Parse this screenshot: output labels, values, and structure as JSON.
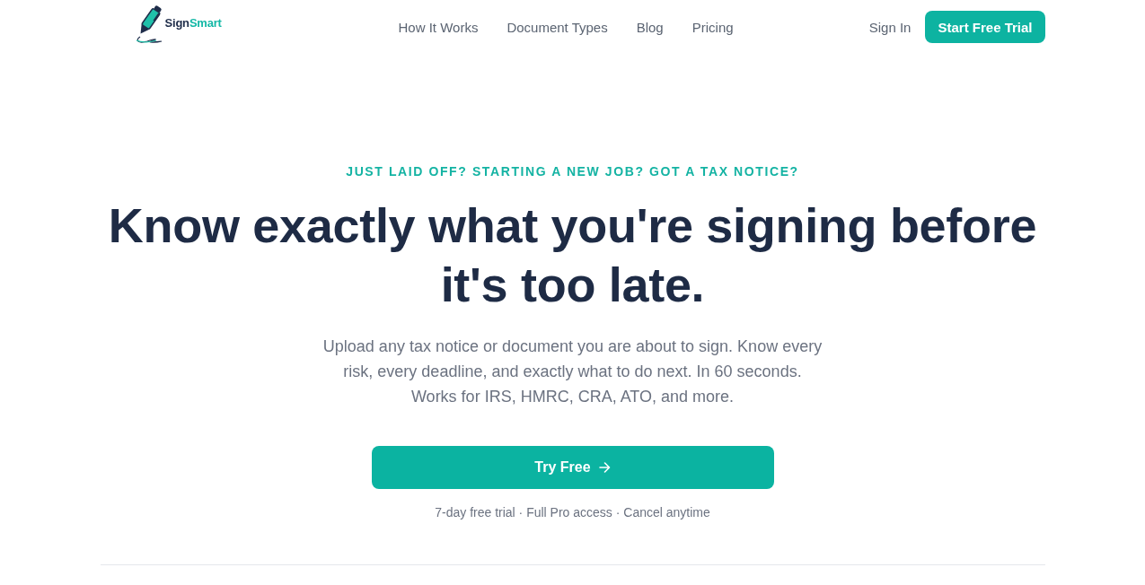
{
  "header": {
    "logo": {
      "name_parts": [
        "Sign",
        "Smart"
      ]
    },
    "nav_links": [
      "How It Works",
      "Document Types",
      "Blog",
      "Pricing"
    ],
    "sign_in": "Sign In",
    "cta": "Start Free Trial"
  },
  "hero": {
    "eyebrow": "JUST LAID OFF? STARTING A NEW JOB? GOT A TAX NOTICE?",
    "heading": "Know exactly what you're signing before it's too late.",
    "description": [
      "Upload any tax notice or document you are about to sign. Know every risk, every deadline, and exactly what to do next. In 60 seconds.",
      "Works for IRS, HMRC, CRA, ATO, and more."
    ],
    "button": "Try Free",
    "note": "7-day free trial · Full Pro access · Cancel anytime"
  }
}
